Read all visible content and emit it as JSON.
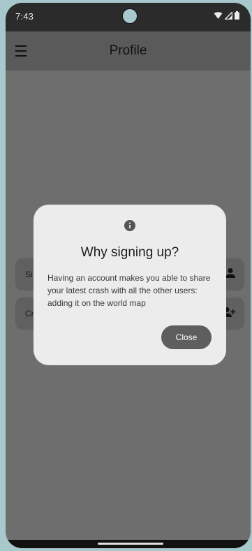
{
  "status_bar": {
    "time": "7:43"
  },
  "app_bar": {
    "title": "Profile",
    "menu_icon": "hamburger-menu-icon"
  },
  "list": {
    "sign_in_label": "Si",
    "sign_in_icon": "person-icon",
    "create_label": "Cr",
    "create_icon": "person-add-icon"
  },
  "dialog": {
    "icon": "info-icon",
    "title": "Why signing up?",
    "body": "Having an account makes you able to share your latest crash with all the other users: adding it on the world map",
    "close_label": "Close"
  },
  "colors": {
    "background": "#a7c9cc",
    "status_bar": "#2b2b2b",
    "app_bar": "#5a5a5a",
    "scrim": "#6e6e6e",
    "dialog": "#ececec",
    "close_button": "#5e5e5e"
  }
}
